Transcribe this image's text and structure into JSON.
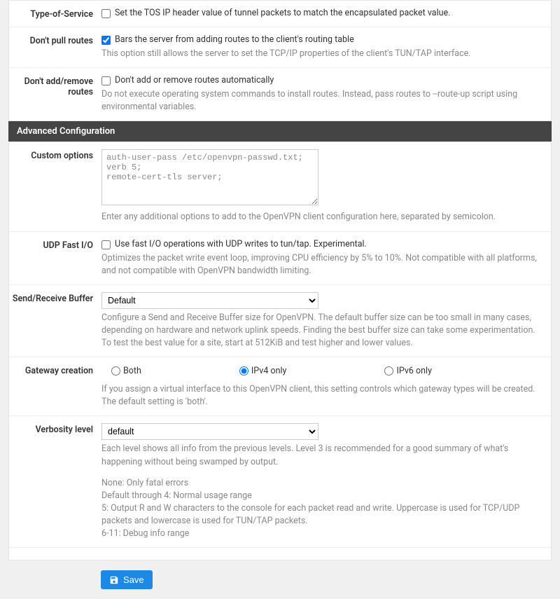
{
  "rows": {
    "tos": {
      "label": "Type-of-Service",
      "check_text": "Set the TOS IP header value of tunnel packets to match the encapsulated packet value."
    },
    "pull": {
      "label": "Don't pull routes",
      "check_text": "Bars the server from adding routes to the client's routing table",
      "help": "This option still allows the server to set the TCP/IP properties of the client's TUN/TAP interface."
    },
    "addremove": {
      "label": "Don't add/remove routes",
      "check_text": "Don't add or remove routes automatically",
      "help": "Do not execute operating system commands to install routes. Instead, pass routes to --route-up script using environmental variables."
    },
    "custom": {
      "label": "Custom options",
      "value": "auth-user-pass /etc/openvpn-passwd.txt;\nverb 5;\nremote-cert-tls server;",
      "help": "Enter any additional options to add to the OpenVPN client configuration here, separated by semicolon."
    },
    "fastio": {
      "label": "UDP Fast I/O",
      "check_text": "Use fast I/O operations with UDP writes to tun/tap. Experimental.",
      "help": "Optimizes the packet write event loop, improving CPU efficiency by 5% to 10%. Not compatible with all platforms, and not compatible with OpenVPN bandwidth limiting."
    },
    "buffer": {
      "label": "Send/Receive Buffer",
      "selected": "Default",
      "help": "Configure a Send and Receive Buffer size for OpenVPN. The default buffer size can be too small in many cases, depending on hardware and network uplink speeds. Finding the best buffer size can take some experimentation. To test the best value for a site, start at 512KiB and test higher and lower values."
    },
    "gateway": {
      "label": "Gateway creation",
      "opt_both": "Both",
      "opt_v4": "IPv4 only",
      "opt_v6": "IPv6 only",
      "help": "If you assign a virtual interface to this OpenVPN client, this setting controls which gateway types will be created. The default setting is 'both'."
    },
    "verbosity": {
      "label": "Verbosity level",
      "selected": "default",
      "help1": "Each level shows all info from the previous levels. Level 3 is recommended for a good summary of what's happening without being swamped by output.",
      "help2": "None: Only fatal errors",
      "help3": "Default through 4: Normal usage range",
      "help4": "5: Output R and W characters to the console for each packet read and write. Uppercase is used for TCP/UDP packets and lowercase is used for TUN/TAP packets.",
      "help5": "6-11: Debug info range"
    }
  },
  "section_header": "Advanced Configuration",
  "save_label": "Save"
}
